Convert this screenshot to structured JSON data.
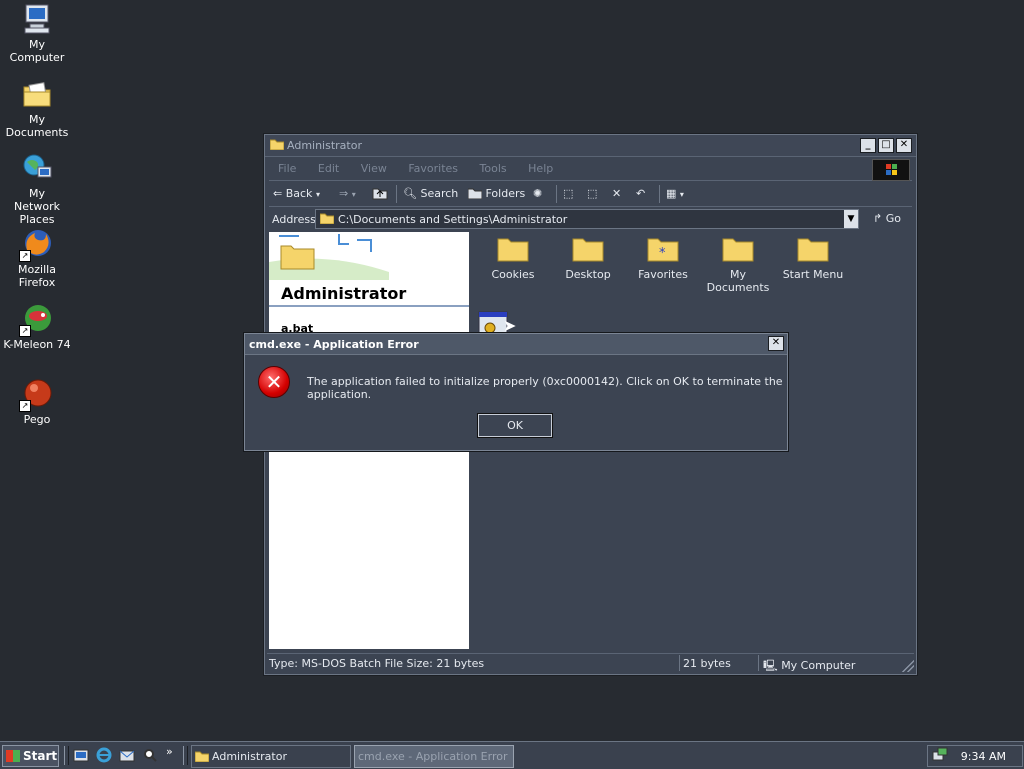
{
  "desktop": {
    "icons": [
      {
        "label": "My Computer"
      },
      {
        "label": "My Documents"
      },
      {
        "label": "My Network Places"
      },
      {
        "label": "Mozilla Firefox"
      },
      {
        "label": "K-Meleon 74"
      },
      {
        "label": "Pego"
      }
    ]
  },
  "explorer": {
    "title": "Administrator",
    "menu": [
      "File",
      "Edit",
      "View",
      "Favorites",
      "Tools",
      "Help"
    ],
    "toolbar": {
      "back": "Back",
      "search": "Search",
      "folders": "Folders"
    },
    "address": {
      "label": "Address",
      "value": "C:\\Documents and Settings\\Administrator",
      "go": "Go"
    },
    "left_pane": {
      "title": "Administrator",
      "selected_file": "a.bat"
    },
    "folders": [
      {
        "label": "Cookies"
      },
      {
        "label": "Desktop"
      },
      {
        "label": "Favorites"
      },
      {
        "label": "My Documents"
      },
      {
        "label": "Start Menu"
      }
    ],
    "status": {
      "info": "Type: MS-DOS Batch File Size: 21 bytes",
      "size": "21 bytes",
      "zone": "My Computer"
    }
  },
  "dialog": {
    "title": "cmd.exe - Application Error",
    "message": "The application failed to initialize properly (0xc0000142). Click on OK to terminate the application.",
    "ok": "OK"
  },
  "taskbar": {
    "start": "Start",
    "tasks": [
      {
        "label": "Administrator",
        "active": false
      },
      {
        "label": "cmd.exe - Application Error",
        "active": true
      }
    ],
    "clock": "9:34 AM"
  },
  "colors": {
    "desktop": "#272b31",
    "window": "#3c4452",
    "error": "#d40000",
    "folder": "#f5d46a"
  }
}
